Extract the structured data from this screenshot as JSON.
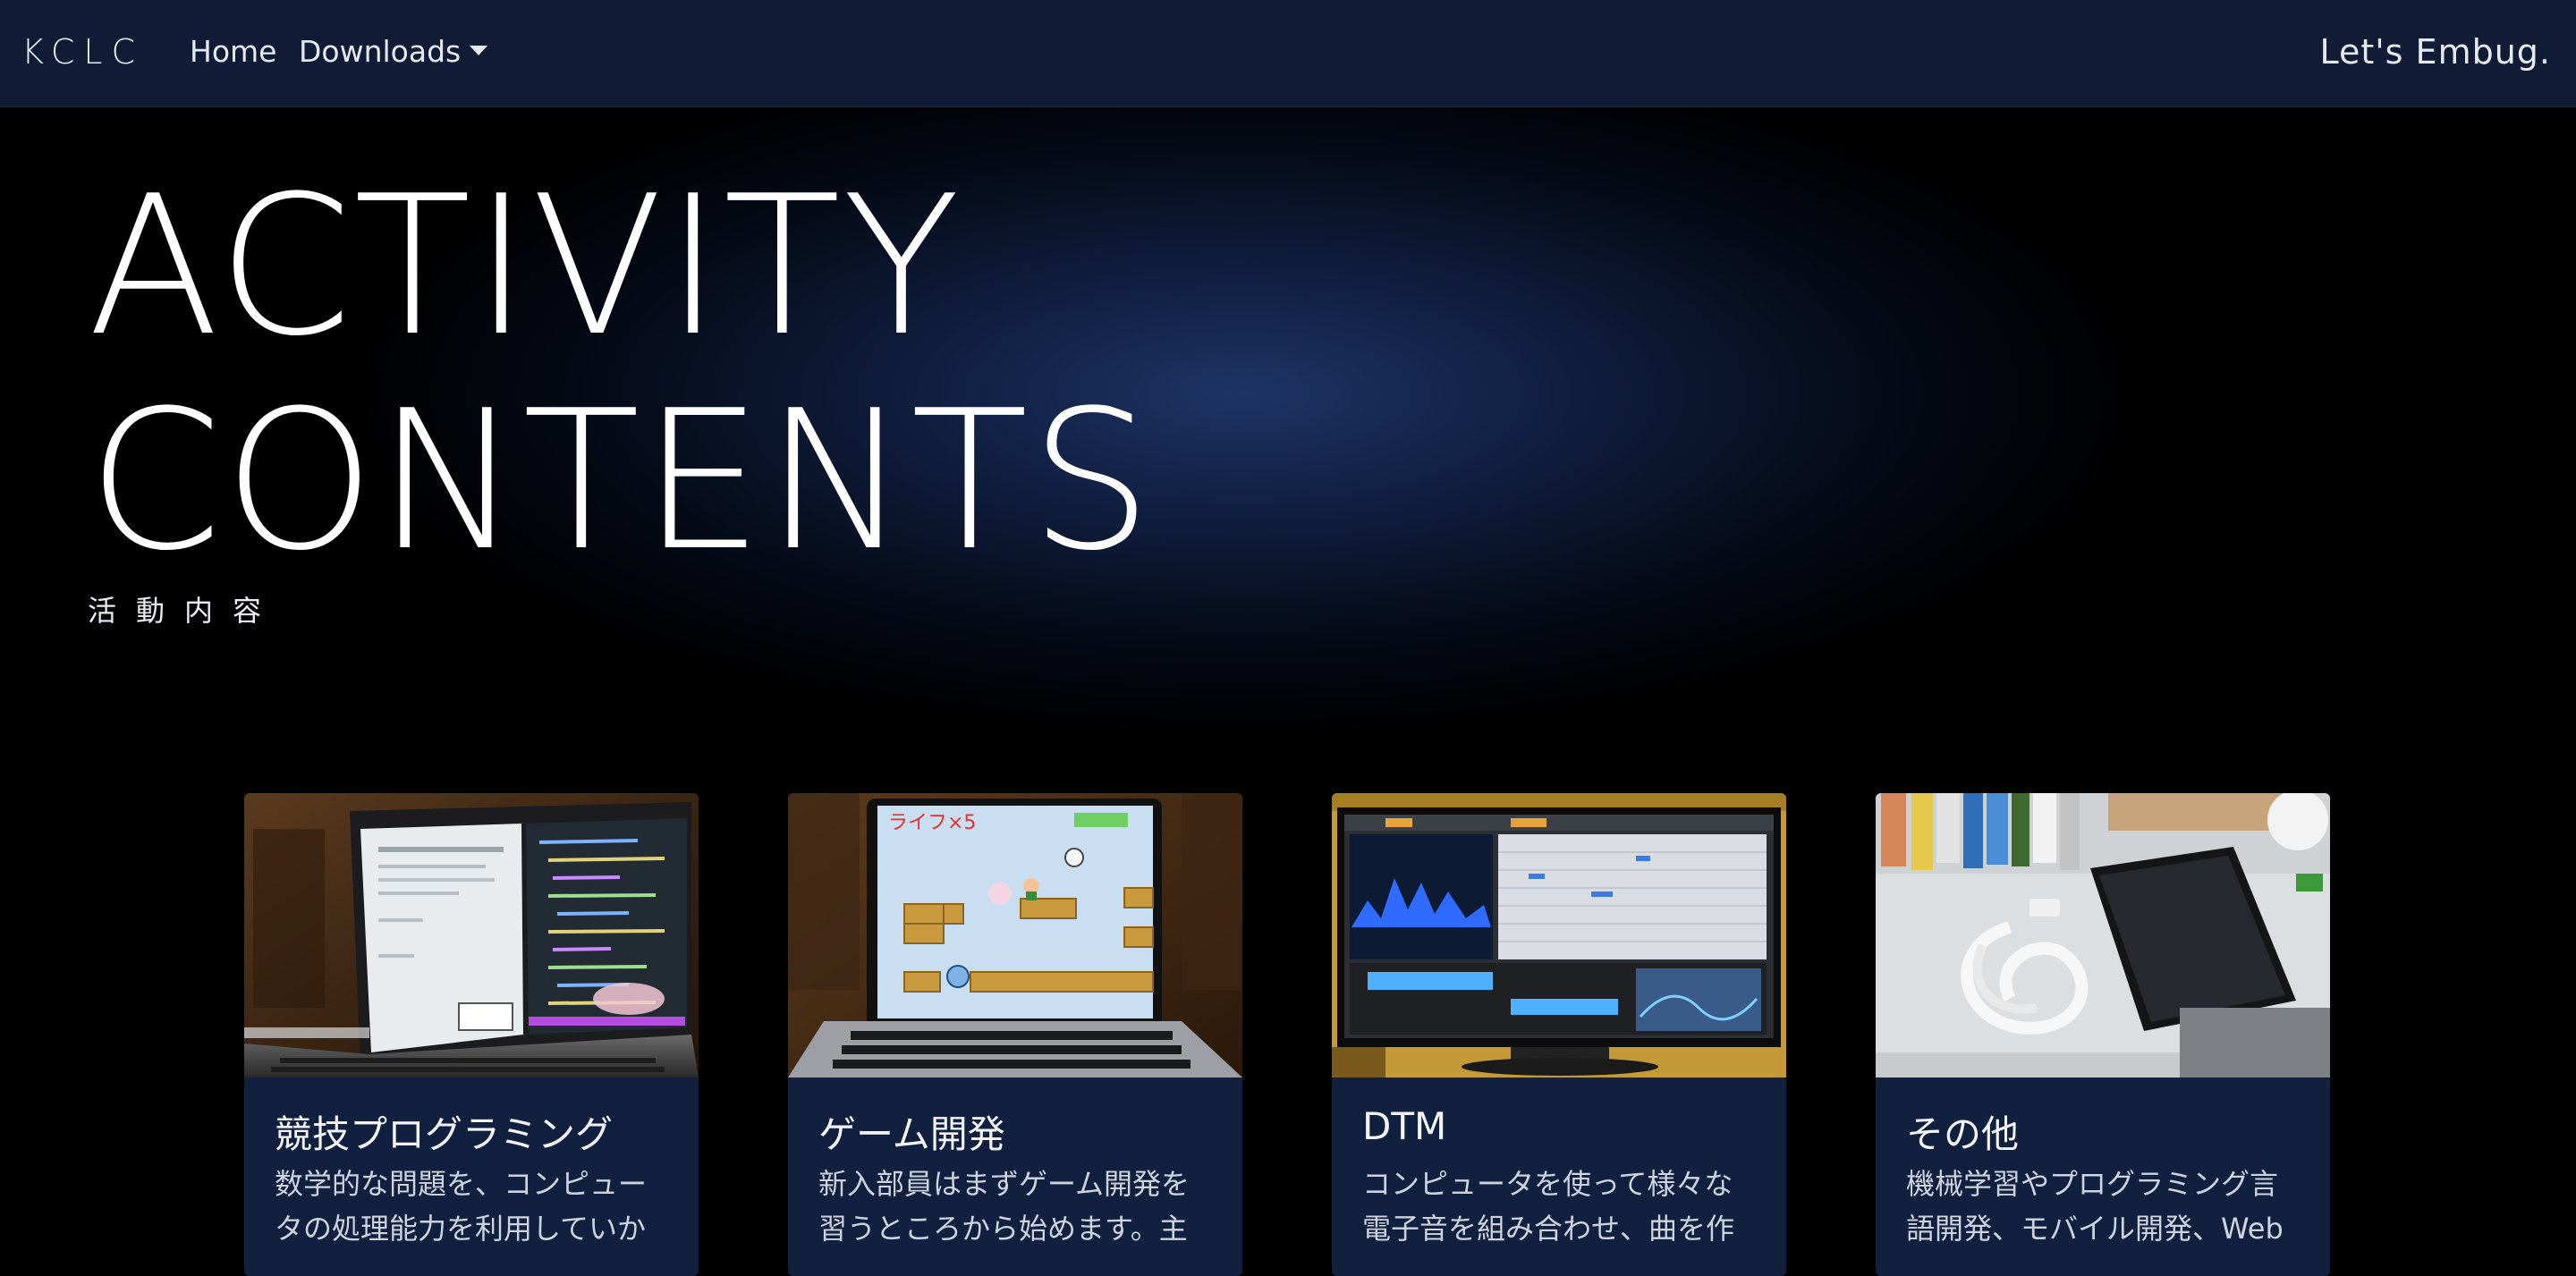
{
  "navbar": {
    "brand": "KCLC",
    "home": "Home",
    "downloads": "Downloads",
    "tagline": "Let's Embug."
  },
  "hero": {
    "title_line1": "ACTIVITY",
    "title_line2": "CONTENTS",
    "subtitle": "活動内容"
  },
  "cards": [
    {
      "title": "競技プログラミング",
      "text": "数学的な問題を、コンピュータの処理能力を利用していか",
      "image_icon": "laptop-code-photo"
    },
    {
      "title": "ゲーム開発",
      "text": "新入部員はまずゲーム開発を習うところから始めます。主",
      "image_icon": "game-screen-photo",
      "game_lives": "ライフ×5"
    },
    {
      "title": "DTM",
      "text": "コンピュータを使って様々な電子音を組み合わせ、曲を作",
      "image_icon": "daw-monitor-photo"
    },
    {
      "title": "その他",
      "text": "機械学習やプログラミング言語開発、モバイル開発、Web",
      "image_icon": "smartphone-photo"
    }
  ],
  "colors": {
    "navbar_bg": "#101c36",
    "card_bg": "#12203f",
    "hero_glow": "#1d3466"
  }
}
